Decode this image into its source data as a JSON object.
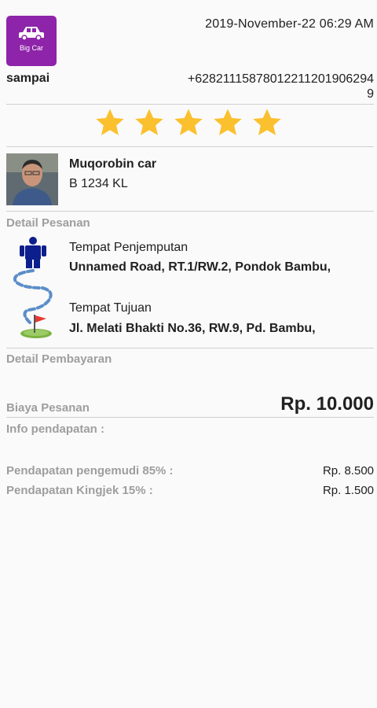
{
  "header": {
    "service_label": "Big Car",
    "status": "sampai",
    "datetime": "2019-November-22 06:29 AM",
    "phone": "+6282111587801221120​19062949"
  },
  "rating": {
    "value": 5,
    "max": 5,
    "star_color": "#fbc02d"
  },
  "driver": {
    "name": "Muqorobin car",
    "plate": "B 1234 KL"
  },
  "order": {
    "section_title": "Detail Pesanan",
    "pickup_label": "Tempat Penjemputan",
    "pickup_address": "Unnamed Road, RT.1/RW.2, Pondok Bambu,",
    "destination_label": "Tempat Tujuan",
    "destination_address": "Jl. Melati Bhakti No.36, RW.9, Pd. Bambu,"
  },
  "payment": {
    "section_title": "Detail Pembayaran",
    "fee_label": "Biaya Pesanan",
    "fee_value": "Rp. 10.000",
    "income_title": "Info pendapatan :",
    "rows": [
      {
        "label": "Pendapatan pengemudi 85% :",
        "value": "Rp. 8.500"
      },
      {
        "label": "Pendapatan Kingjek 15% :",
        "value": "Rp. 1.500"
      }
    ]
  },
  "colors": {
    "service_bg": "#8e24aa",
    "person_icon": "#0d1f8c",
    "route_line": "#5b8ec9",
    "flag": "#e53935",
    "green": "#7cb342"
  }
}
